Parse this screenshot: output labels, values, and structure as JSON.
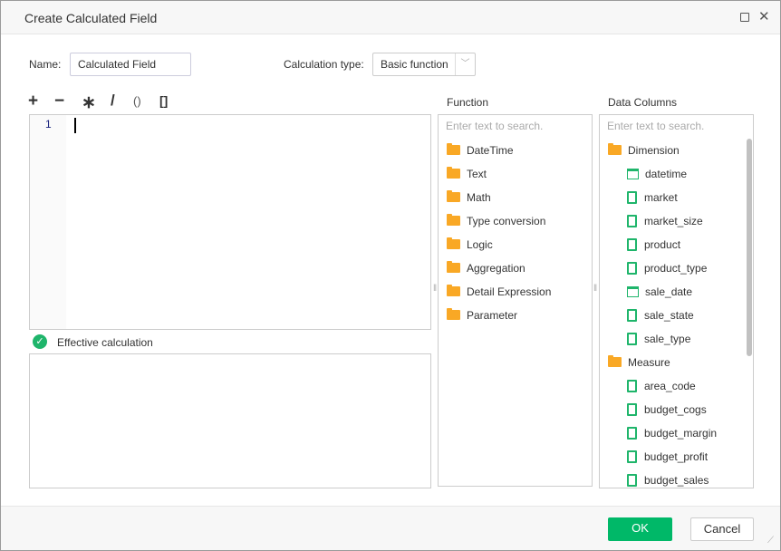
{
  "dialog": {
    "title": "Create Calculated Field",
    "maximize_icon": "square-icon",
    "close_icon": "close-icon"
  },
  "form": {
    "name_label": "Name:",
    "name_value": "Calculated Field",
    "calc_type_label": "Calculation type:",
    "calc_type_value": "Basic function"
  },
  "toolbar": {
    "plus": "+",
    "minus": "−",
    "multiply": "∗",
    "divide": "/",
    "parens": "()",
    "brackets": "[]"
  },
  "editor": {
    "line_number": "1",
    "content": ""
  },
  "status": {
    "text": "Effective calculation",
    "icon": "check-circle-icon",
    "color": "#1fb56b"
  },
  "function_panel": {
    "title": "Function",
    "search_placeholder": "Enter text to search.",
    "items": [
      "DateTime",
      "Text",
      "Math",
      "Type conversion",
      "Logic",
      "Aggregation",
      "Detail Expression",
      "Parameter"
    ]
  },
  "columns_panel": {
    "title": "Data Columns",
    "search_placeholder": "Enter text to search.",
    "items": [
      {
        "label": "Dimension",
        "type": "folder"
      },
      {
        "label": "datetime",
        "type": "date"
      },
      {
        "label": "market",
        "type": "text"
      },
      {
        "label": "market_size",
        "type": "text"
      },
      {
        "label": "product",
        "type": "text"
      },
      {
        "label": "product_type",
        "type": "text"
      },
      {
        "label": "sale_date",
        "type": "date"
      },
      {
        "label": "sale_state",
        "type": "text"
      },
      {
        "label": "sale_type",
        "type": "text"
      },
      {
        "label": "Measure",
        "type": "folder"
      },
      {
        "label": "area_code",
        "type": "text"
      },
      {
        "label": "budget_cogs",
        "type": "text"
      },
      {
        "label": "budget_margin",
        "type": "text"
      },
      {
        "label": "budget_profit",
        "type": "text"
      },
      {
        "label": "budget_sales",
        "type": "text"
      }
    ]
  },
  "buttons": {
    "ok": "OK",
    "cancel": "Cancel"
  },
  "colors": {
    "accent": "#00b868",
    "folder": "#f9a825"
  }
}
